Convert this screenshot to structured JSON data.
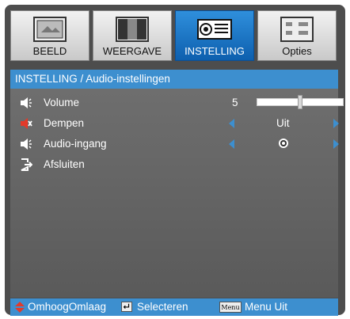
{
  "tabs": [
    {
      "label": "BEELD",
      "icon": "image-icon",
      "active": false
    },
    {
      "label": "WEERGAVE",
      "icon": "display-icon",
      "active": false
    },
    {
      "label": "INSTELLING",
      "icon": "projector-icon",
      "active": true
    },
    {
      "label": "Opties",
      "icon": "options-icon",
      "active": false
    }
  ],
  "breadcrumb": "INSTELLING / Audio-instellingen",
  "rows": {
    "volume": {
      "label": "Volume",
      "value": "5",
      "level_percent": 50
    },
    "mute": {
      "label": "Dempen",
      "value": "Uit"
    },
    "audio_input": {
      "label": "Audio-ingang"
    },
    "exit": {
      "label": "Afsluiten"
    }
  },
  "footer": {
    "nav": "OmhoogOmlaag",
    "select": "Selecteren",
    "menu_key": "Menu",
    "menu": "Menu Uit"
  },
  "colors": {
    "accent": "#3d8fcf",
    "mute_icon": "#e23a2a"
  }
}
